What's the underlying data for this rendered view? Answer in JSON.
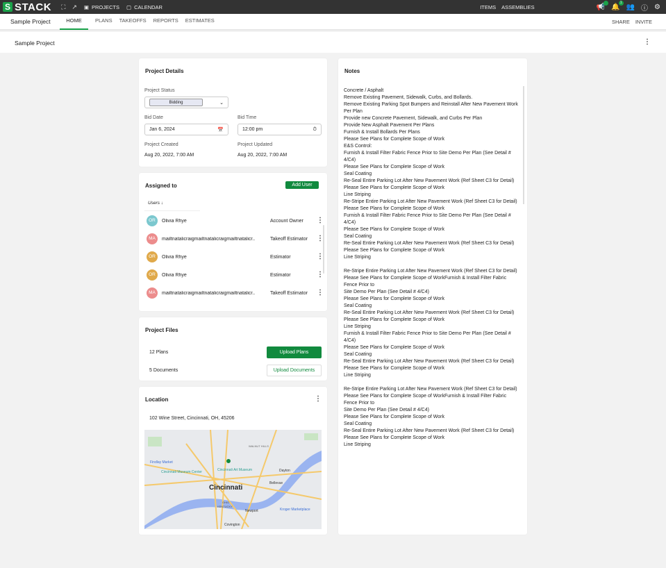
{
  "topbar": {
    "brand": "STACK",
    "projects": "PROJECTS",
    "calendar": "CALENDAR",
    "items": "ITEMS",
    "assemblies": "ASSEMBLIES",
    "notif_count": "1"
  },
  "subnav": {
    "project": "Sample Project",
    "tabs": [
      "HOME",
      "PLANS",
      "TAKEOFFS",
      "REPORTS",
      "ESTIMATES"
    ],
    "share": "SHARE",
    "invite": "INVITE"
  },
  "page": {
    "title": "Sample Project"
  },
  "details": {
    "title": "Project Details",
    "status_label": "Project Status",
    "status": "Bidding",
    "bid_date_label": "Bid Date",
    "bid_date": "Jan 6, 2024",
    "bid_time_label": "Bid Time",
    "bid_time": "12:00 pm",
    "created_label": "Project Created",
    "created": "Aug 20, 2022, 7:00 AM",
    "updated_label": "Project Updated",
    "updated": "Aug 20, 2022, 7:00 AM"
  },
  "assigned": {
    "title": "Assigned to",
    "add_user": "Add User",
    "users_header": "Users",
    "users": [
      {
        "initials": "OR",
        "name": "Olivia Rhye",
        "role": "Account Owner",
        "color": "#7cc8cf"
      },
      {
        "initials": "MA",
        "name": "mailtnatalicraigmailtnatalicraigmailtnatalicr..",
        "role": "Takeoff Estimator",
        "color": "#ec8c8c"
      },
      {
        "initials": "OR",
        "name": "Olivia Rhye",
        "role": "Estimator",
        "color": "#e0a94a"
      },
      {
        "initials": "OR",
        "name": "Olivia Rhye",
        "role": "Estimator",
        "color": "#e0a94a"
      },
      {
        "initials": "MA",
        "name": "mailtnatalicraigmailtnatalicraigmailtnatalicr..",
        "role": "Takeoff Estimator",
        "color": "#ec8c8c"
      }
    ]
  },
  "files": {
    "title": "Project Files",
    "plans": "12 Plans",
    "documents": "5  Documents",
    "upload_plans": "Upload Plans",
    "upload_documents": "Upload Documents"
  },
  "location": {
    "title": "Location",
    "address": "102  Wine Street, Cincinnati, OH, 45206",
    "map_labels": {
      "city": "Cincinnati",
      "findlay": "Findlay Market",
      "art": "Cincinnati Art Museum",
      "museum": "Cincinnati Museum Center",
      "dayton": "Dayton",
      "bellevue": "Bellevue",
      "newport": "Newport",
      "covington": "Covington",
      "kroger": "Kroger Marketplace",
      "walnut": "WALNUT HILLS",
      "ohio": "OHIO",
      "kentucky": "KENTUCKY"
    }
  },
  "notes": {
    "title": "Notes",
    "text": "Concrete / Asphalt\nRemove Existing Pavement, Sidewalk, Curbs, and Bollards.\nRemove Existing Parking Spot Bumpers and Reinstall After New Pavement Work Per Plan\nProvide new Concrete Pavement, Sidewalk, and Curbs Per Plan\nProvide New Asphalt Pavement Per Plans\nFurnish & Install Bollards Per Plans\nPlease See Plans for Complete Scope of Work\nE&S Control:\nFurnish & Install Filter Fabric Fence Prior to Site Demo Per Plan (See Detail # 4/C4)\nPlease See Plans for Complete Scope of Work\nSeal Coating\nRe-Seal Entire Parking Lot After New Pavement Work (Ref Sheet C3 for Detail)\nPlease See Plans for Complete Scope of Work\nLine Striping\nRe-Stripe Entire Parking Lot After New Pavement Work (Ref Sheet C3 for Detail)\nPlease See Plans for Complete Scope of Work\nFurnish & Install Filter Fabric Fence Prior to Site Demo Per Plan (See Detail # 4/C4)\nPlease See Plans for Complete Scope of Work\nSeal Coating\nRe-Seal Entire Parking Lot After New Pavement Work (Ref Sheet C3 for Detail)\nPlease See Plans for Complete Scope of Work\nLine Striping\n\nRe-Stripe Entire Parking Lot After New Pavement Work (Ref Sheet C3 for Detail)\nPlease See Plans for Complete Scope of WorkFurnish & Install Filter Fabric Fence Prior to\nSite Demo Per Plan (See Detail # 4/C4)\nPlease See Plans for Complete Scope of Work\nSeal Coating\nRe-Seal Entire Parking Lot After New Pavement Work (Ref Sheet C3 for Detail)\nPlease See Plans for Complete Scope of Work\nLine Striping\nFurnish & Install Filter Fabric Fence Prior to Site Demo Per Plan (See Detail # 4/C4)\nPlease See Plans for Complete Scope of Work\nSeal Coating\nRe-Seal Entire Parking Lot After New Pavement Work (Ref Sheet C3 for Detail)\nPlease See Plans for Complete Scope of Work\nLine Striping\n\nRe-Stripe Entire Parking Lot After New Pavement Work (Ref Sheet C3 for Detail)\nPlease See Plans for Complete Scope of WorkFurnish & Install Filter Fabric Fence Prior to\nSite Demo Per Plan (See Detail # 4/C4)\nPlease See Plans for Complete Scope of Work\nSeal Coating\nRe-Seal Entire Parking Lot After New Pavement Work (Ref Sheet C3 for Detail)\nPlease See Plans for Complete Scope of Work\nLine Striping"
  },
  "colors": {
    "brand": "#1aa34a",
    "button": "#118a3e",
    "topbar": "#333333"
  }
}
